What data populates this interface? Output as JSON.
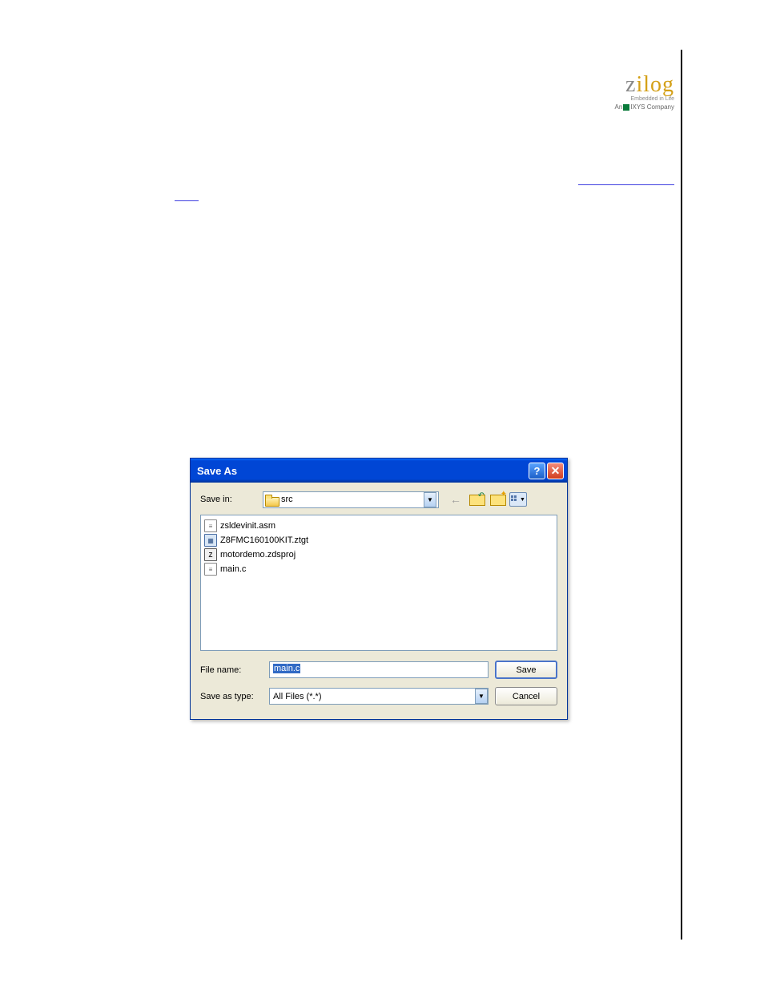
{
  "logo": {
    "main_z": "z",
    "main_rest": "ilog",
    "tagline1": "Embedded in Life",
    "tagline2_prefix": "An",
    "tagline2_brand": "IXYS",
    "tagline2_suffix": "Company"
  },
  "dialog": {
    "title": "Save As",
    "save_in_label": "Save in:",
    "save_in_value": "src",
    "file_name_label": "File name:",
    "file_name_value": "main.c",
    "save_as_type_label": "Save as type:",
    "save_as_type_value": "All Files (*.*)",
    "save_button": "Save",
    "cancel_button": "Cancel",
    "files": [
      {
        "icon": "doc",
        "name": "zsldevinit.asm"
      },
      {
        "icon": "ztgt",
        "name": "Z8FMC160100KIT.ztgt"
      },
      {
        "icon": "proj",
        "name": "motordemo.zdsproj"
      },
      {
        "icon": "doc",
        "name": "main.c"
      }
    ],
    "icon_glyphs": {
      "doc": "≡",
      "ztgt": "▦",
      "proj": "Z"
    }
  }
}
